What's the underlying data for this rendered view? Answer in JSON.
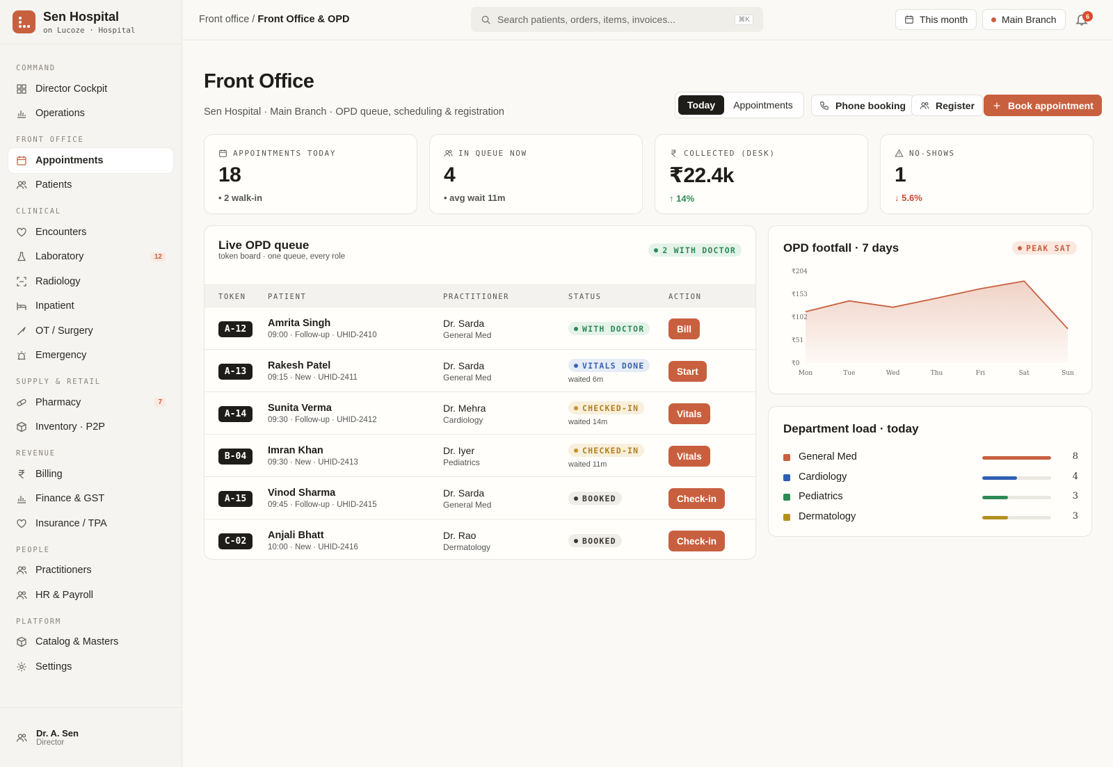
{
  "brand": {
    "name": "Sen Hospital",
    "sub": "on Lucoze · Hospital"
  },
  "sidebar": {
    "sections": [
      {
        "label": "COMMAND",
        "items": [
          {
            "label": "Director Cockpit",
            "icon": "grid-icon"
          },
          {
            "label": "Operations",
            "icon": "bar-chart-icon"
          }
        ]
      },
      {
        "label": "FRONT OFFICE",
        "items": [
          {
            "label": "Appointments",
            "icon": "calendar-icon",
            "active": true
          },
          {
            "label": "Patients",
            "icon": "users-icon"
          }
        ]
      },
      {
        "label": "CLINICAL",
        "items": [
          {
            "label": "Encounters",
            "icon": "heart-icon"
          },
          {
            "label": "Laboratory",
            "icon": "flask-icon",
            "badge": "12"
          },
          {
            "label": "Radiology",
            "icon": "scan-icon"
          },
          {
            "label": "Inpatient",
            "icon": "bed-icon"
          },
          {
            "label": "OT / Surgery",
            "icon": "scalpel-icon"
          },
          {
            "label": "Emergency",
            "icon": "siren-icon"
          }
        ]
      },
      {
        "label": "SUPPLY & RETAIL",
        "items": [
          {
            "label": "Pharmacy",
            "icon": "pill-icon",
            "badge": "7"
          },
          {
            "label": "Inventory · P2P",
            "icon": "box-icon"
          }
        ]
      },
      {
        "label": "REVENUE",
        "items": [
          {
            "label": "Billing",
            "icon": "rupee-icon"
          },
          {
            "label": "Finance & GST",
            "icon": "bar-chart-icon"
          },
          {
            "label": "Insurance / TPA",
            "icon": "heart-icon"
          }
        ]
      },
      {
        "label": "PEOPLE",
        "items": [
          {
            "label": "Practitioners",
            "icon": "users-icon"
          },
          {
            "label": "HR & Payroll",
            "icon": "users-icon"
          }
        ]
      },
      {
        "label": "PLATFORM",
        "items": [
          {
            "label": "Catalog & Masters",
            "icon": "box-icon"
          },
          {
            "label": "Settings",
            "icon": "gear-icon"
          }
        ]
      }
    ],
    "user": {
      "name": "Dr. A. Sen",
      "role": "Director"
    }
  },
  "topbar": {
    "crumb_parent": "Front office / ",
    "crumb_current": "Front Office & OPD",
    "search_placeholder": "Search patients, orders, items, invoices...",
    "search_kbd": "⌘K",
    "period": "This month",
    "branch": "Main Branch",
    "notifications": "6"
  },
  "page": {
    "title": "Front Office",
    "subtitle": "Sen Hospital · Main Branch · OPD queue, scheduling & registration",
    "tabs": [
      "Today",
      "Appointments"
    ],
    "active_tab": "Today",
    "actions": {
      "phone": "Phone booking",
      "register": "Register",
      "book": "Book appointment"
    }
  },
  "stats": [
    {
      "label": "APPOINTMENTS TODAY",
      "icon": "calendar-icon",
      "value": "18",
      "delta": "2 walk-in",
      "delta_kind": "dot"
    },
    {
      "label": "IN QUEUE NOW",
      "icon": "users-icon",
      "value": "4",
      "delta": "avg wait 11m",
      "delta_kind": "dot"
    },
    {
      "label": "COLLECTED (DESK)",
      "icon": "rupee-icon",
      "value": "₹22.4k",
      "delta": "14%",
      "delta_kind": "up"
    },
    {
      "label": "NO-SHOWS",
      "icon": "warning-icon",
      "value": "1",
      "delta": "5.6%",
      "delta_kind": "down"
    }
  ],
  "queue": {
    "title": "Live OPD queue",
    "subtitle": "token board · one queue, every role",
    "badge": "2 WITH DOCTOR",
    "columns": [
      "TOKEN",
      "PATIENT",
      "PRACTITIONER",
      "STATUS",
      "ACTION"
    ],
    "rows": [
      {
        "token": "A-12",
        "name": "Amrita Singh",
        "meta": "09:00 · Follow-up · UHID-2410",
        "doctor": "Dr. Sarda",
        "dept": "General Med",
        "status": "WITH DOCTOR",
        "tone": "green",
        "wait": "",
        "action": "Bill"
      },
      {
        "token": "A-13",
        "name": "Rakesh Patel",
        "meta": "09:15 · New · UHID-2411",
        "doctor": "Dr. Sarda",
        "dept": "General Med",
        "status": "VITALS DONE",
        "tone": "blue",
        "wait": "waited 6m",
        "action": "Start"
      },
      {
        "token": "A-14",
        "name": "Sunita Verma",
        "meta": "09:30 · Follow-up · UHID-2412",
        "doctor": "Dr. Mehra",
        "dept": "Cardiology",
        "status": "CHECKED-IN",
        "tone": "amber",
        "wait": "waited 14m",
        "action": "Vitals"
      },
      {
        "token": "B-04",
        "name": "Imran Khan",
        "meta": "09:30 · New · UHID-2413",
        "doctor": "Dr. Iyer",
        "dept": "Pediatrics",
        "status": "CHECKED-IN",
        "tone": "amber",
        "wait": "waited 11m",
        "action": "Vitals"
      },
      {
        "token": "A-15",
        "name": "Vinod Sharma",
        "meta": "09:45 · Follow-up · UHID-2415",
        "doctor": "Dr. Sarda",
        "dept": "General Med",
        "status": "BOOKED",
        "tone": "grey",
        "wait": "",
        "action": "Check-in"
      },
      {
        "token": "C-02",
        "name": "Anjali Bhatt",
        "meta": "10:00 · New · UHID-2416",
        "doctor": "Dr. Rao",
        "dept": "Dermatology",
        "status": "BOOKED",
        "tone": "grey",
        "wait": "",
        "action": "Check-in"
      }
    ]
  },
  "chart_data": {
    "type": "area",
    "title": "OPD footfall · 7 days",
    "annotation": "PEAK SAT",
    "categories": [
      "Mon",
      "Tue",
      "Wed",
      "Thu",
      "Fri",
      "Sat",
      "Sun"
    ],
    "values": [
      114,
      138,
      124,
      144,
      165,
      182,
      76
    ],
    "yticks": [
      "₹204",
      "₹153",
      "₹102",
      "₹51",
      "₹0"
    ],
    "ylim": [
      0,
      204
    ],
    "color": "#c8603f",
    "grid": false
  },
  "departments": {
    "title": "Department load · today",
    "max": 8,
    "items": [
      {
        "name": "General Med",
        "value": 8,
        "color": "#c8603f"
      },
      {
        "name": "Cardiology",
        "value": 4,
        "color": "#2f5fb3"
      },
      {
        "name": "Pediatrics",
        "value": 3,
        "color": "#2e8a55"
      },
      {
        "name": "Dermatology",
        "value": 3,
        "color": "#b3901e"
      }
    ]
  }
}
